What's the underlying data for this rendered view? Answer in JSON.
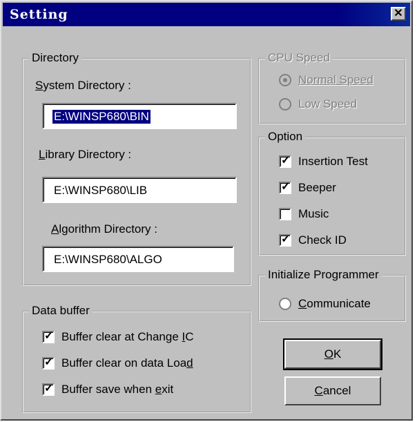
{
  "window": {
    "title": "Setting",
    "close_glyph": "✕"
  },
  "directory": {
    "legend": "Directory",
    "system": {
      "label_u": "S",
      "label_rest": "ystem Directory :",
      "value": "E:\\WINSP680\\BIN"
    },
    "library": {
      "label_u": "L",
      "label_rest": "ibrary Directory :",
      "value": "E:\\WINSP680\\LIB"
    },
    "algorithm": {
      "label_u": "A",
      "label_rest": "lgorithm Directory :",
      "value": "E:\\WINSP680\\ALGO"
    }
  },
  "cpu_speed": {
    "legend": "CPU Speed",
    "normal": {
      "label": "Normal Speed",
      "selected": true
    },
    "low": {
      "label": "Low Speed",
      "selected": false
    }
  },
  "option": {
    "legend": "Option",
    "insertion_test": {
      "label": "Insertion Test",
      "checked": true
    },
    "beeper": {
      "label": "Beeper",
      "checked": true
    },
    "music": {
      "label": "Music",
      "checked": false
    },
    "check_id": {
      "label": "Check ID",
      "checked": true
    }
  },
  "init": {
    "legend": "Initialize Programmer",
    "communicate": {
      "label_u": "C",
      "label_rest": "ommunicate",
      "selected": false
    }
  },
  "data_buffer": {
    "legend": "Data buffer",
    "clear_change": {
      "label_pre": "Buffer clear at Change ",
      "label_u": "I",
      "label_post": "C",
      "checked": true
    },
    "clear_load": {
      "label_pre": "Buffer clear on data Loa",
      "label_u": "d",
      "label_post": "",
      "checked": true
    },
    "save_exit": {
      "label_pre": "Buffer save when ",
      "label_u": "e",
      "label_post": "xit",
      "checked": true
    }
  },
  "buttons": {
    "ok": {
      "label_u": "O",
      "label_rest": "K"
    },
    "cancel": {
      "label_u": "C",
      "label_rest": "ancel"
    }
  },
  "check_glyph": "✓"
}
